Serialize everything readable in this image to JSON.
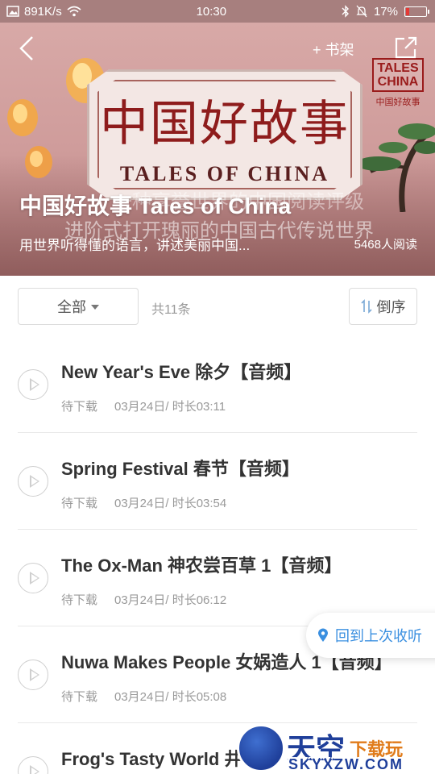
{
  "status_bar": {
    "network_speed": "891K/s",
    "time": "10:30",
    "battery": "17%",
    "battery_level": 0.17
  },
  "header": {
    "shelf_label": "+ 书架",
    "banner_cn": "中国好故事",
    "banner_en": "TALES OF CHINA",
    "logo_en": "TALES CHINA",
    "logo_cn": "中国好故事",
    "watermark_line1": "一种享誉世界的中国阅读评级",
    "watermark_line2": "进阶式打开瑰丽的中国古代传说世界",
    "title": "中国好故事 Tales of China",
    "subtitle": "用世界听得懂的语言，讲述美丽中国...",
    "readers": "5468人阅读"
  },
  "filters": {
    "all_label": "全部",
    "total": "共11条",
    "sort_label": "倒序"
  },
  "episodes": [
    {
      "title": "New Year's Eve 除夕【音频】",
      "status": "待下载",
      "meta": "03月24日/ 时长03:11"
    },
    {
      "title": "Spring Festival 春节【音频】",
      "status": "待下载",
      "meta": "03月24日/ 时长03:54"
    },
    {
      "title": "The Ox-Man 神农尝百草 1【音频】",
      "status": "待下载",
      "meta": "03月24日/ 时长06:12"
    },
    {
      "title": "Nuwa Makes People 女娲造人 1【音频】",
      "status": "待下载",
      "meta": "03月24日/ 时长05:08"
    },
    {
      "title": "Frog's Tasty World 井",
      "status": "",
      "meta": ""
    }
  ],
  "resume_label": "回到上次收听",
  "site_watermark": {
    "name": "天空",
    "tag": "下载玩",
    "url": "SKYXZW.COM"
  },
  "colors": {
    "accent": "#3a8fe0",
    "hero_bg": "#cf9c9b",
    "banner_red": "#8e1c1c"
  }
}
